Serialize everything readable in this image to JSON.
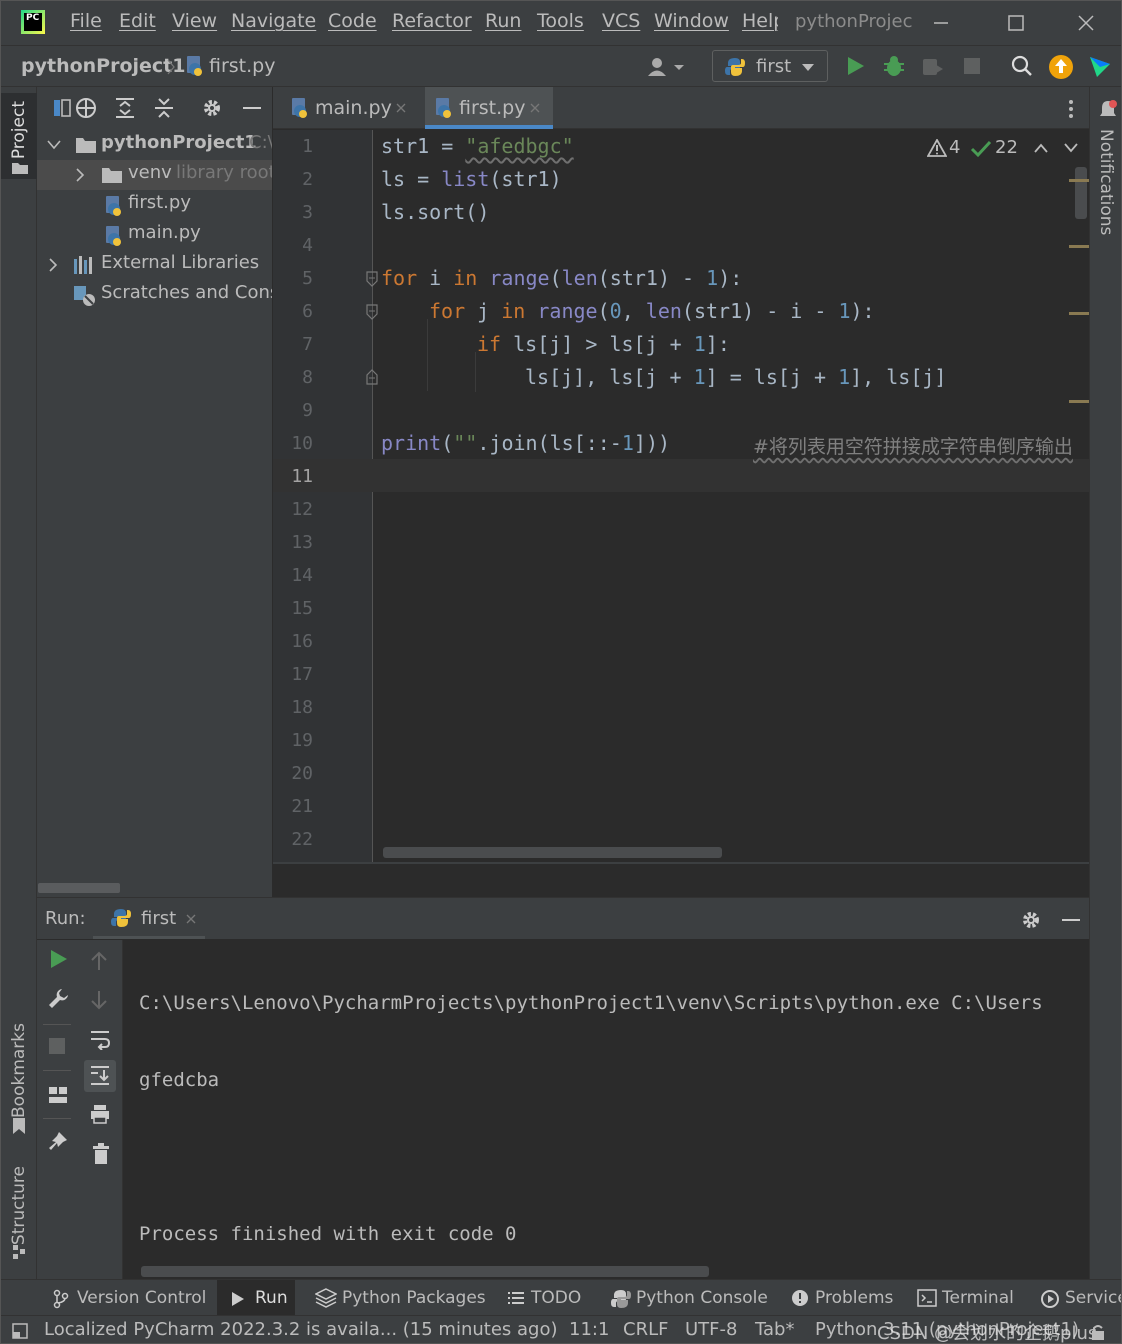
{
  "menubar": {
    "items": [
      "File",
      "Edit",
      "View",
      "Navigate",
      "Code",
      "Refactor",
      "Run",
      "Tools",
      "VCS",
      "Window",
      "Help"
    ],
    "project_title": "pythonProjec",
    "app_icon": "pycharm-logo"
  },
  "navbar": {
    "breadcrumb_project": "pythonProject1",
    "breadcrumb_file": "first.py",
    "run_config": "first"
  },
  "sidebar": {
    "left_labels": {
      "project": "Project",
      "bookmarks": "Bookmarks",
      "structure": "Structure"
    },
    "right_labels": {
      "notifications": "Notifications"
    }
  },
  "project_tree": {
    "root_name": "pythonProject1",
    "root_path": "C:\\",
    "venv_name": "venv",
    "venv_hint": "library root",
    "files": [
      "first.py",
      "main.py"
    ],
    "external": "External Libraries",
    "scratches": "Scratches and Consoles"
  },
  "editor": {
    "tabs": [
      "main.py",
      "first.py"
    ],
    "active_tab": "first.py",
    "warnings_count": "4",
    "ok_count": "22",
    "line_numbers": [
      "1",
      "2",
      "3",
      "4",
      "5",
      "6",
      "7",
      "8",
      "9",
      "10",
      "11",
      "12",
      "13",
      "14",
      "15",
      "16",
      "17",
      "18",
      "19",
      "20",
      "21",
      "22"
    ],
    "current_line": "11",
    "code": {
      "l1_var": "str1",
      "l1_op": " = ",
      "l1_str": "\"afedbgc\"",
      "l2_a": "ls = ",
      "l2_fn": "list",
      "l2_b": "(str1)",
      "l3": "ls.sort()",
      "l5_for": "for",
      "l5_a": " i ",
      "l5_in": "in",
      "l5_range": " range",
      "l5_b": "(",
      "l5_len": "len",
      "l5_c": "(str1) - ",
      "l5_num": "1",
      "l5_d": "):",
      "l6_for": "for",
      "l6_a": " j ",
      "l6_in": "in",
      "l6_range": " range",
      "l6_b": "(",
      "l6_zero": "0",
      "l6_c": ", ",
      "l6_len": "len",
      "l6_d": "(str1) - i - ",
      "l6_num": "1",
      "l6_e": "):",
      "l7_if": "if",
      "l7_a": " ls[j] > ls[j + ",
      "l7_num": "1",
      "l7_b": "]:",
      "l8_a": "ls[j], ls[j + ",
      "l8_num": "1",
      "l8_b": "] = ls[j + ",
      "l8_num2": "1",
      "l8_c": "], ls[j]",
      "l10_print": "print",
      "l10_a": "(",
      "l10_str": "\"\"",
      "l10_b": ".join(ls[::-",
      "l10_num": "1",
      "l10_c": "]))",
      "l10_comment": "#将列表用空符拼接成字符串倒序输出"
    }
  },
  "run_panel": {
    "label": "Run:",
    "tab": "first",
    "output": [
      "C:\\Users\\Lenovo\\PycharmProjects\\pythonProject1\\venv\\Scripts\\python.exe C:\\Users",
      "gfedcba",
      "",
      "Process finished with exit code 0"
    ]
  },
  "bottom_tabs": [
    "Version Control",
    "Run",
    "Python Packages",
    "TODO",
    "Python Console",
    "Problems",
    "Terminal",
    "Services"
  ],
  "status": {
    "message": "Localized PyCharm 2022.3.2 is availa... (15 minutes ago)",
    "position": "11:1",
    "line_sep": "CRLF",
    "encoding": "UTF-8",
    "indent": "Tab*",
    "interpreter": "Python 3.11 (pythonProject1)",
    "watermark": "CSDN @会划水的企鹅plus"
  },
  "colors": {
    "keyword": "#cc7832",
    "string": "#6a8759",
    "number": "#6897bb",
    "builtin": "#8888c6",
    "comment": "#808080",
    "run_green": "#499c54",
    "active_tab_underline": "#4a88c7",
    "update_orange": "#f0a30a"
  }
}
